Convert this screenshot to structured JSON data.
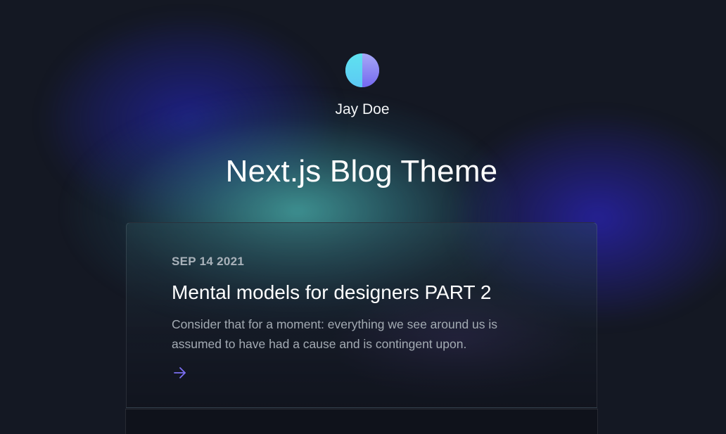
{
  "header": {
    "author_name": "Jay Doe",
    "site_title": "Next.js Blog Theme"
  },
  "posts": [
    {
      "date": "SEP 14 2021",
      "title": "Mental models for designers PART 2",
      "excerpt": "Consider that for a moment: everything we see around us is assumed to have had a cause and is contingent upon.",
      "arrow_icon": "arrow-right-icon"
    }
  ],
  "colors": {
    "background": "#141823",
    "accent_arrow": "#7b6ff2",
    "avatar_left": "#53d8ee",
    "avatar_right": "#7468ef"
  }
}
